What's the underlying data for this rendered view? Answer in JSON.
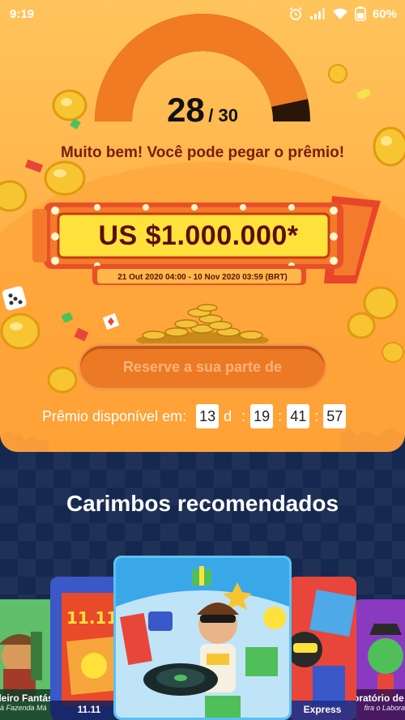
{
  "status_bar": {
    "time": "9:19",
    "battery": "60%"
  },
  "progress": {
    "current": "28",
    "separator": "/ 30",
    "fraction": 0.933
  },
  "message": "Muito bem! Você pode pegar o prêmio!",
  "prize": {
    "amount": "US $1.000.000*",
    "date_range": "21 Out 2020 04:00 - 10 Nov 2020 03:59 (BRT)"
  },
  "reserve_button": "Reserve a sua parte de",
  "countdown": {
    "label": "Prêmio disponível em:",
    "days": "13",
    "days_unit": "d",
    "hours": "19",
    "minutes": "41",
    "seconds": "57",
    "colon": ":"
  },
  "section_title": "Carimbos recomendados",
  "cards": [
    {
      "title": "endeiro Fantást",
      "subtitle": "a à Fazenda Má"
    },
    {
      "title": "11.11",
      "subtitle": ""
    },
    {
      "title": "",
      "subtitle": ""
    },
    {
      "title": "Express",
      "subtitle": ""
    },
    {
      "title": "oratório de En",
      "subtitle": "fira o Laborat"
    }
  ],
  "colors": {
    "accent": "#f07b22",
    "banner_yellow": "#ffe13b",
    "panel": "#ffb44a",
    "bottom_bg": "#15284f"
  }
}
